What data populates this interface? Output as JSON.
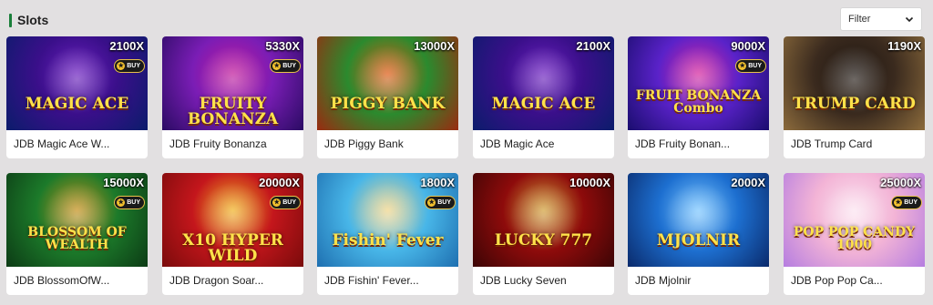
{
  "section": {
    "title": "Slots"
  },
  "filter": {
    "label": "Filter",
    "icon": "chevron-down-icon"
  },
  "games": [
    {
      "name": "JDB Magic Ace W...",
      "multiplier": "2100X",
      "buy": "BUY",
      "logo_text": "MAGIC ACE",
      "colors": [
        "#3a0f8a",
        "#0b1c6b",
        "#6b1fbf"
      ]
    },
    {
      "name": "JDB Fruity Bonanza",
      "multiplier": "5330X",
      "buy": "BUY",
      "logo_text": "FRUITY BONANZA",
      "colors": [
        "#7a1db5",
        "#2a0b63",
        "#c0199b"
      ]
    },
    {
      "name": "JDB Piggy Bank",
      "multiplier": "13000X",
      "buy": "",
      "logo_text": "PIGGY BANK",
      "colors": [
        "#2b8a2e",
        "#9a2a10",
        "#e05a14"
      ]
    },
    {
      "name": "JDB Magic Ace",
      "multiplier": "2100X",
      "buy": "",
      "logo_text": "MAGIC ACE",
      "colors": [
        "#3a0f8a",
        "#0b1c6b",
        "#6b1fbf"
      ]
    },
    {
      "name": "JDB Fruity Bonan...",
      "multiplier": "9000X",
      "buy": "BUY",
      "logo_text": "FRUIT BONANZA Combo",
      "colors": [
        "#5a22c9",
        "#1a0d6e",
        "#d6269e"
      ]
    },
    {
      "name": "JDB Trump Card",
      "multiplier": "1190X",
      "buy": "",
      "logo_text": "TRUMP CARD",
      "colors": [
        "#3a2a1e",
        "#8c6b3c",
        "#1d1510"
      ]
    },
    {
      "name": "JDB BlossomOfW...",
      "multiplier": "15000X",
      "buy": "BUY",
      "logo_text": "BLOSSOM OF WEALTH",
      "colors": [
        "#1c7a2a",
        "#0c3b15",
        "#c58f1a"
      ]
    },
    {
      "name": "JDB Dragon Soar...",
      "multiplier": "20000X",
      "buy": "BUY",
      "logo_text": "X10 HYPER WILD",
      "colors": [
        "#c4161c",
        "#7a0b0b",
        "#f0b324"
      ]
    },
    {
      "name": "JDB Fishin' Fever...",
      "multiplier": "1800X",
      "buy": "BUY",
      "logo_text": "Fishin' Fever",
      "colors": [
        "#48b6e8",
        "#1e6fb0",
        "#f0d487"
      ]
    },
    {
      "name": "JDB Lucky Seven",
      "multiplier": "10000X",
      "buy": "",
      "logo_text": "LUCKY 777",
      "colors": [
        "#8e0b0b",
        "#3b0505",
        "#d1a13a"
      ]
    },
    {
      "name": "JDB Mjolnir",
      "multiplier": "2000X",
      "buy": "",
      "logo_text": "MJOLNIR",
      "colors": [
        "#1d6fd0",
        "#0a2a6b",
        "#7ac6ff"
      ]
    },
    {
      "name": "JDB Pop Pop Ca...",
      "multiplier": "25000X",
      "buy": "BUY",
      "logo_text": "POP POP CANDY 1000",
      "colors": [
        "#f3b4d6",
        "#b57de0",
        "#fbe4f0"
      ]
    }
  ]
}
